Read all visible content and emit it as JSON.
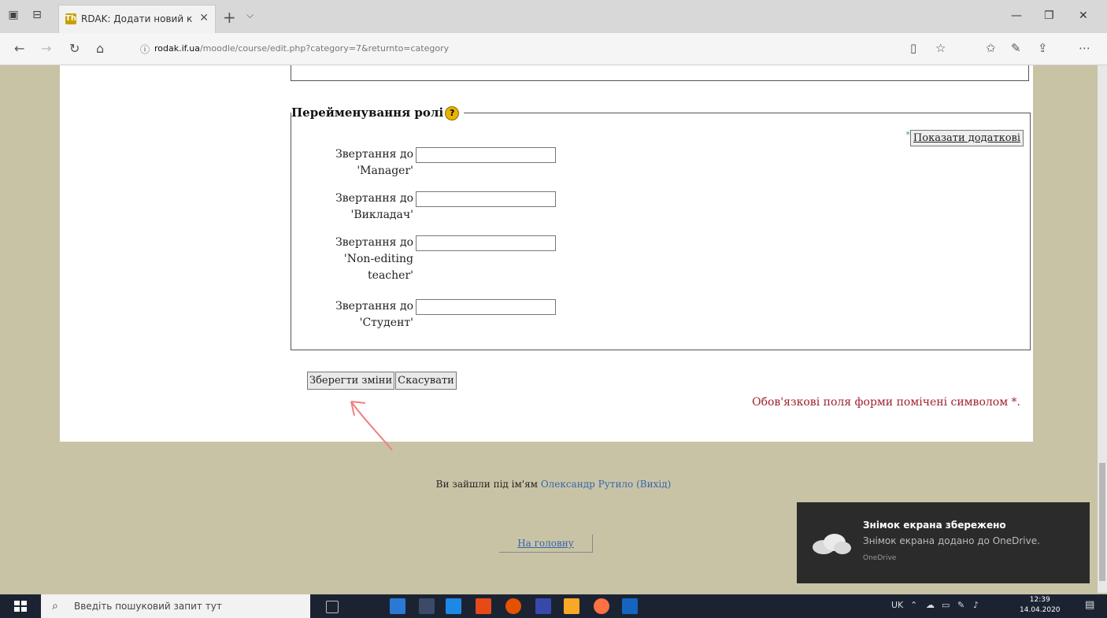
{
  "browser": {
    "tab_title": "RDAK: Додати новий к",
    "tab_favicon": "Th",
    "url_host": "rodak.if.ua",
    "url_path": "/moodle/course/edit.php?category=7&returnto=category"
  },
  "form": {
    "legend": "Перейменування ролі",
    "help_icon": "?",
    "show_more_star": "*",
    "show_more_label": "Показати додаткові",
    "fields": [
      {
        "label": "Звертання до 'Manager'",
        "value": ""
      },
      {
        "label": "Звертання до 'Викладач'",
        "value": ""
      },
      {
        "label": "Звертання до 'Non-editing teacher'",
        "value": ""
      },
      {
        "label": "Звертання до 'Студент'",
        "value": ""
      }
    ],
    "save_label": "Зберегти зміни",
    "cancel_label": "Скасувати",
    "required_note": "Обов'язкові поля форми помічені символом",
    "required_star": "*."
  },
  "footer": {
    "logged_in_prefix": "Ви зайшли під ім'ям",
    "user_name": "Олександр Рутило",
    "logout_label": "(Вихід)",
    "home_label": "На головну"
  },
  "toast": {
    "title": "Знімок екрана збережено",
    "body": "Знімок екрана додано до OneDrive.",
    "source": "OneDrive"
  },
  "taskbar": {
    "search_placeholder": "Введіть пошуковий запит тут",
    "lang": "UK",
    "time": "12:39",
    "date": "14.04.2020"
  },
  "colors": {
    "page_bg": "#c9c3a6",
    "required_text": "#a02030",
    "link": "#3366aa",
    "arrow": "#f08080"
  }
}
